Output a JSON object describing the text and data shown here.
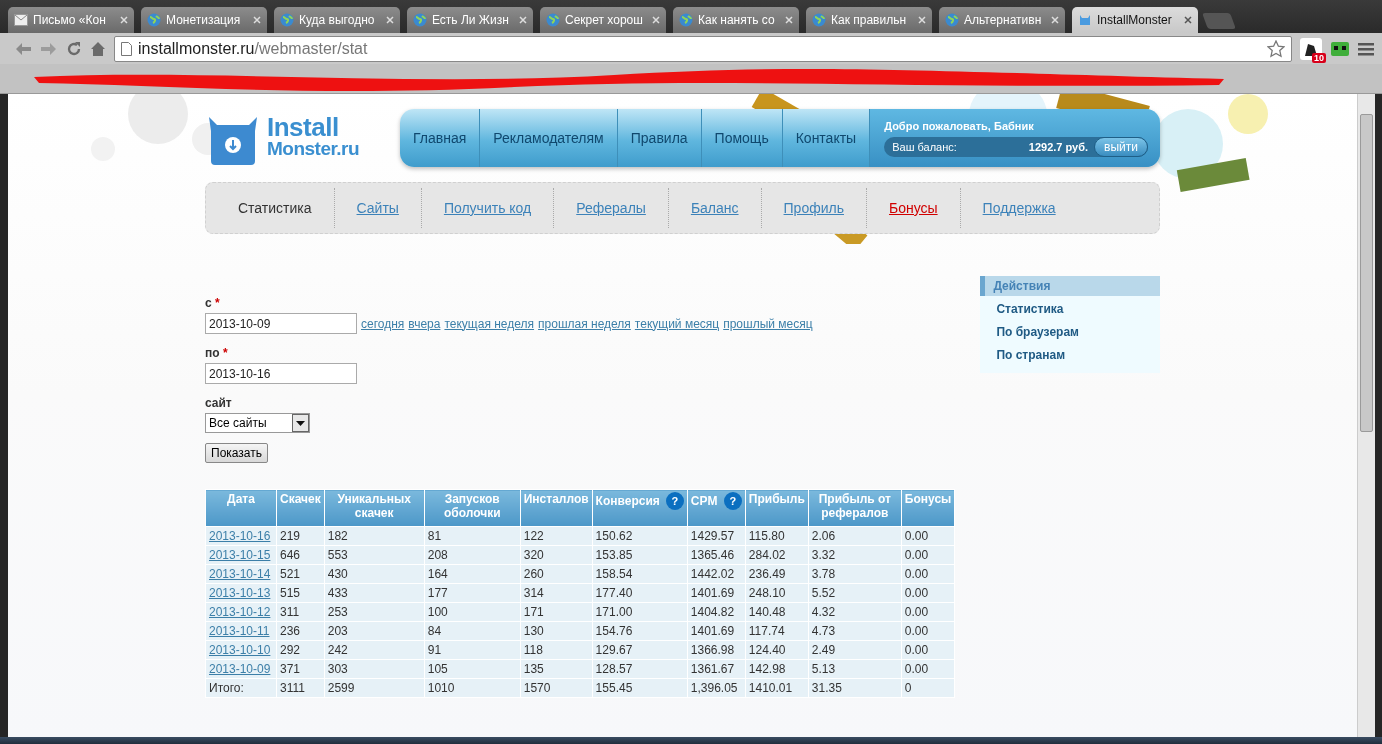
{
  "browser": {
    "tabs": [
      {
        "title": "Письмо «Кон",
        "kind": "mail",
        "selected": false
      },
      {
        "title": "Монетизация",
        "kind": "web",
        "selected": false
      },
      {
        "title": "Куда выгодно",
        "kind": "web",
        "selected": false
      },
      {
        "title": "Есть Ли Жизн",
        "kind": "web",
        "selected": false
      },
      {
        "title": "Секрет хорош",
        "kind": "web",
        "selected": false
      },
      {
        "title": "Как нанять со",
        "kind": "web",
        "selected": false
      },
      {
        "title": "Как правильн",
        "kind": "web",
        "selected": false
      },
      {
        "title": "Альтернативн",
        "kind": "web",
        "selected": false
      },
      {
        "title": "InstallMonster",
        "kind": "site",
        "selected": true
      }
    ],
    "url": {
      "host": "installmonster.ru",
      "path": "/webmaster/stat"
    },
    "extension_badge": "10"
  },
  "header": {
    "logo": {
      "line1": "Install",
      "line2": "Monster.ru"
    },
    "main_nav": [
      "Главная",
      "Рекламодателям",
      "Правила",
      "Помощь",
      "Контакты"
    ],
    "user": {
      "greeting": "Добро пожаловать, Бабник",
      "balance_label": "Ваш баланс:",
      "balance_value": "1292.7 руб.",
      "logout": "выйти"
    }
  },
  "sub_nav": [
    {
      "label": "Статистика",
      "selected": true,
      "color": "#333333"
    },
    {
      "label": "Сайты",
      "selected": false,
      "color": "#3c82b9"
    },
    {
      "label": "Получить код",
      "selected": false,
      "color": "#3c82b9"
    },
    {
      "label": "Рефералы",
      "selected": false,
      "color": "#3c82b9"
    },
    {
      "label": "Баланс",
      "selected": false,
      "color": "#3c82b9"
    },
    {
      "label": "Профиль",
      "selected": false,
      "color": "#3c82b9"
    },
    {
      "label": "Бонусы",
      "selected": false,
      "color": "#d10000"
    },
    {
      "label": "Поддержка",
      "selected": false,
      "color": "#3c82b9"
    }
  ],
  "form": {
    "from": {
      "label": "с",
      "required_mark": "*",
      "value": "2013-10-09"
    },
    "quick_links": [
      "сегодня",
      "вчера",
      "текущая неделя",
      "прошлая неделя",
      "текущий месяц",
      "прошлый месяц"
    ],
    "to": {
      "label": "по",
      "required_mark": "*",
      "value": "2013-10-16"
    },
    "site": {
      "label": "сайт",
      "value": "Все сайты"
    },
    "submit": "Показать"
  },
  "table": {
    "columns": [
      {
        "label": "Дата"
      },
      {
        "label": "Скачек"
      },
      {
        "label": "Уникальных скачек"
      },
      {
        "label": "Запусков оболочки"
      },
      {
        "label": "Инсталлов"
      },
      {
        "label": "Конверсия",
        "help": "?"
      },
      {
        "label": "CPM",
        "help": "?"
      },
      {
        "label": "Прибыль"
      },
      {
        "label": "Прибыль от рефералов"
      },
      {
        "label": "Бонусы"
      }
    ],
    "rows": [
      {
        "kind": "day",
        "cells": [
          "2013-10-16",
          "219",
          "182",
          "81",
          "122",
          "150.62",
          "1429.57",
          "115.80",
          "2.06",
          "0.00"
        ]
      },
      {
        "kind": "day",
        "cells": [
          "2013-10-15",
          "646",
          "553",
          "208",
          "320",
          "153.85",
          "1365.46",
          "284.02",
          "3.32",
          "0.00"
        ]
      },
      {
        "kind": "day",
        "cells": [
          "2013-10-14",
          "521",
          "430",
          "164",
          "260",
          "158.54",
          "1442.02",
          "236.49",
          "3.78",
          "0.00"
        ]
      },
      {
        "kind": "day",
        "cells": [
          "2013-10-13",
          "515",
          "433",
          "177",
          "314",
          "177.40",
          "1401.69",
          "248.10",
          "5.52",
          "0.00"
        ]
      },
      {
        "kind": "day",
        "cells": [
          "2013-10-12",
          "311",
          "253",
          "100",
          "171",
          "171.00",
          "1404.82",
          "140.48",
          "4.32",
          "0.00"
        ]
      },
      {
        "kind": "day",
        "cells": [
          "2013-10-11",
          "236",
          "203",
          "84",
          "130",
          "154.76",
          "1401.69",
          "117.74",
          "4.73",
          "0.00"
        ]
      },
      {
        "kind": "day",
        "cells": [
          "2013-10-10",
          "292",
          "242",
          "91",
          "118",
          "129.67",
          "1366.98",
          "124.40",
          "2.49",
          "0.00"
        ]
      },
      {
        "kind": "day",
        "cells": [
          "2013-10-09",
          "371",
          "303",
          "105",
          "135",
          "128.57",
          "1361.67",
          "142.98",
          "5.13",
          "0.00"
        ]
      },
      {
        "kind": "total",
        "cells": [
          "Итого:",
          "3111",
          "2599",
          "1010",
          "1570",
          "155.45",
          "1,396.05",
          "1410.01",
          "31.35",
          "0"
        ]
      }
    ]
  },
  "sidebar": {
    "title": "Действия",
    "items": [
      "Статистика",
      "По браузерам",
      "По странам"
    ]
  }
}
